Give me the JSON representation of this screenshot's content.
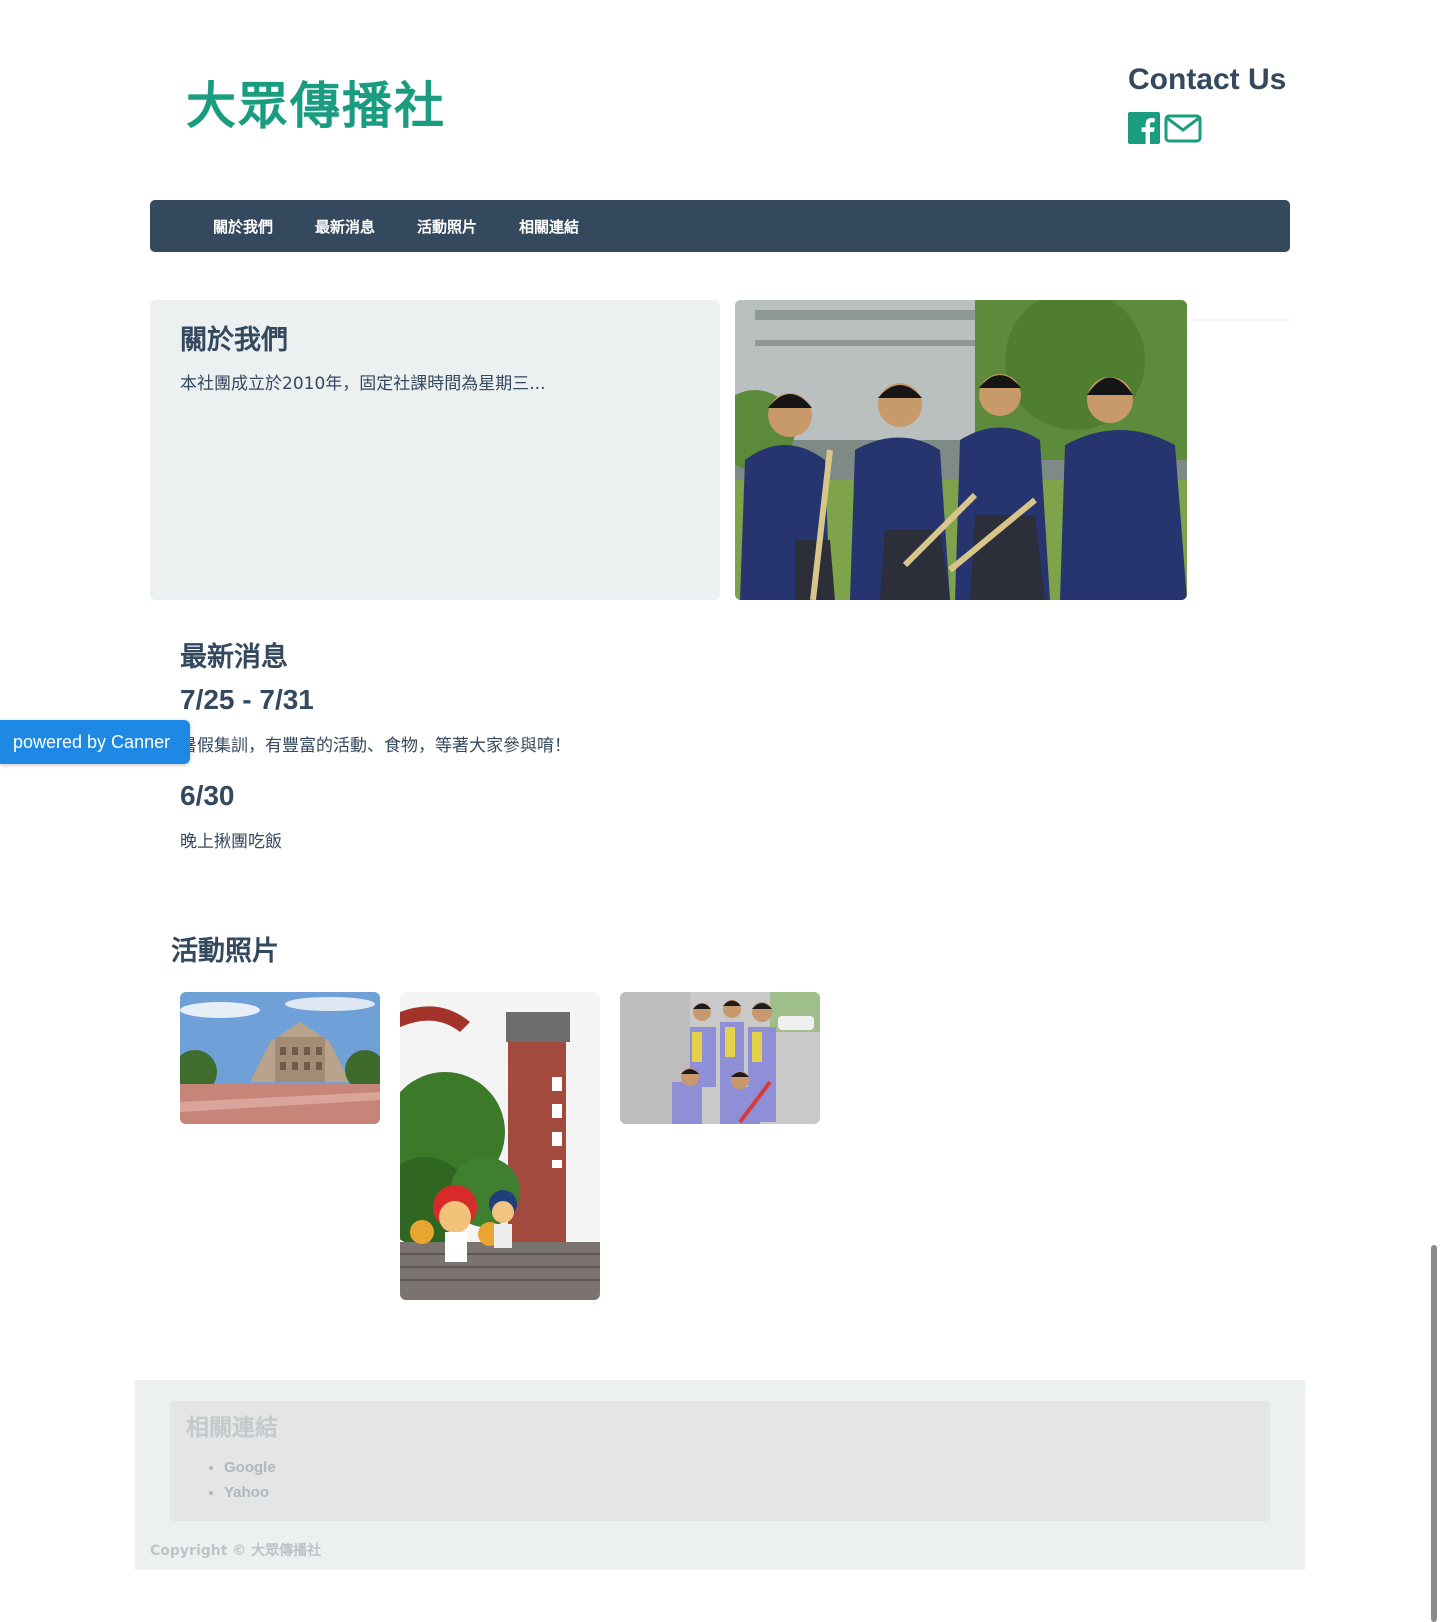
{
  "header": {
    "site_title": "大眾傳播社",
    "contact_title": "Contact Us",
    "icons": [
      "facebook-icon",
      "mail-icon"
    ],
    "accent_color": "#1a9c80"
  },
  "nav": {
    "items": [
      "關於我們",
      "最新消息",
      "活動照片",
      "相關連結"
    ],
    "background": "#34495e"
  },
  "about": {
    "title": "關於我們",
    "text": "本社團成立於2010年，固定社課時間為星期三..."
  },
  "news": {
    "title": "最新消息",
    "items": [
      {
        "date": "7/25 - 7/31",
        "text": "暑假集訓，有豐富的活動、食物，等著大家參與唷！"
      },
      {
        "date": "6/30",
        "text": "晚上揪團吃飯"
      }
    ]
  },
  "badge": {
    "label": "powered by Canner",
    "color": "#1e88e5"
  },
  "photos": {
    "title": "活動照片"
  },
  "footer": {
    "links_title": "相關連結",
    "links": [
      "Google",
      "Yahoo"
    ],
    "copyright": "Copyright © 大眾傳播社"
  }
}
